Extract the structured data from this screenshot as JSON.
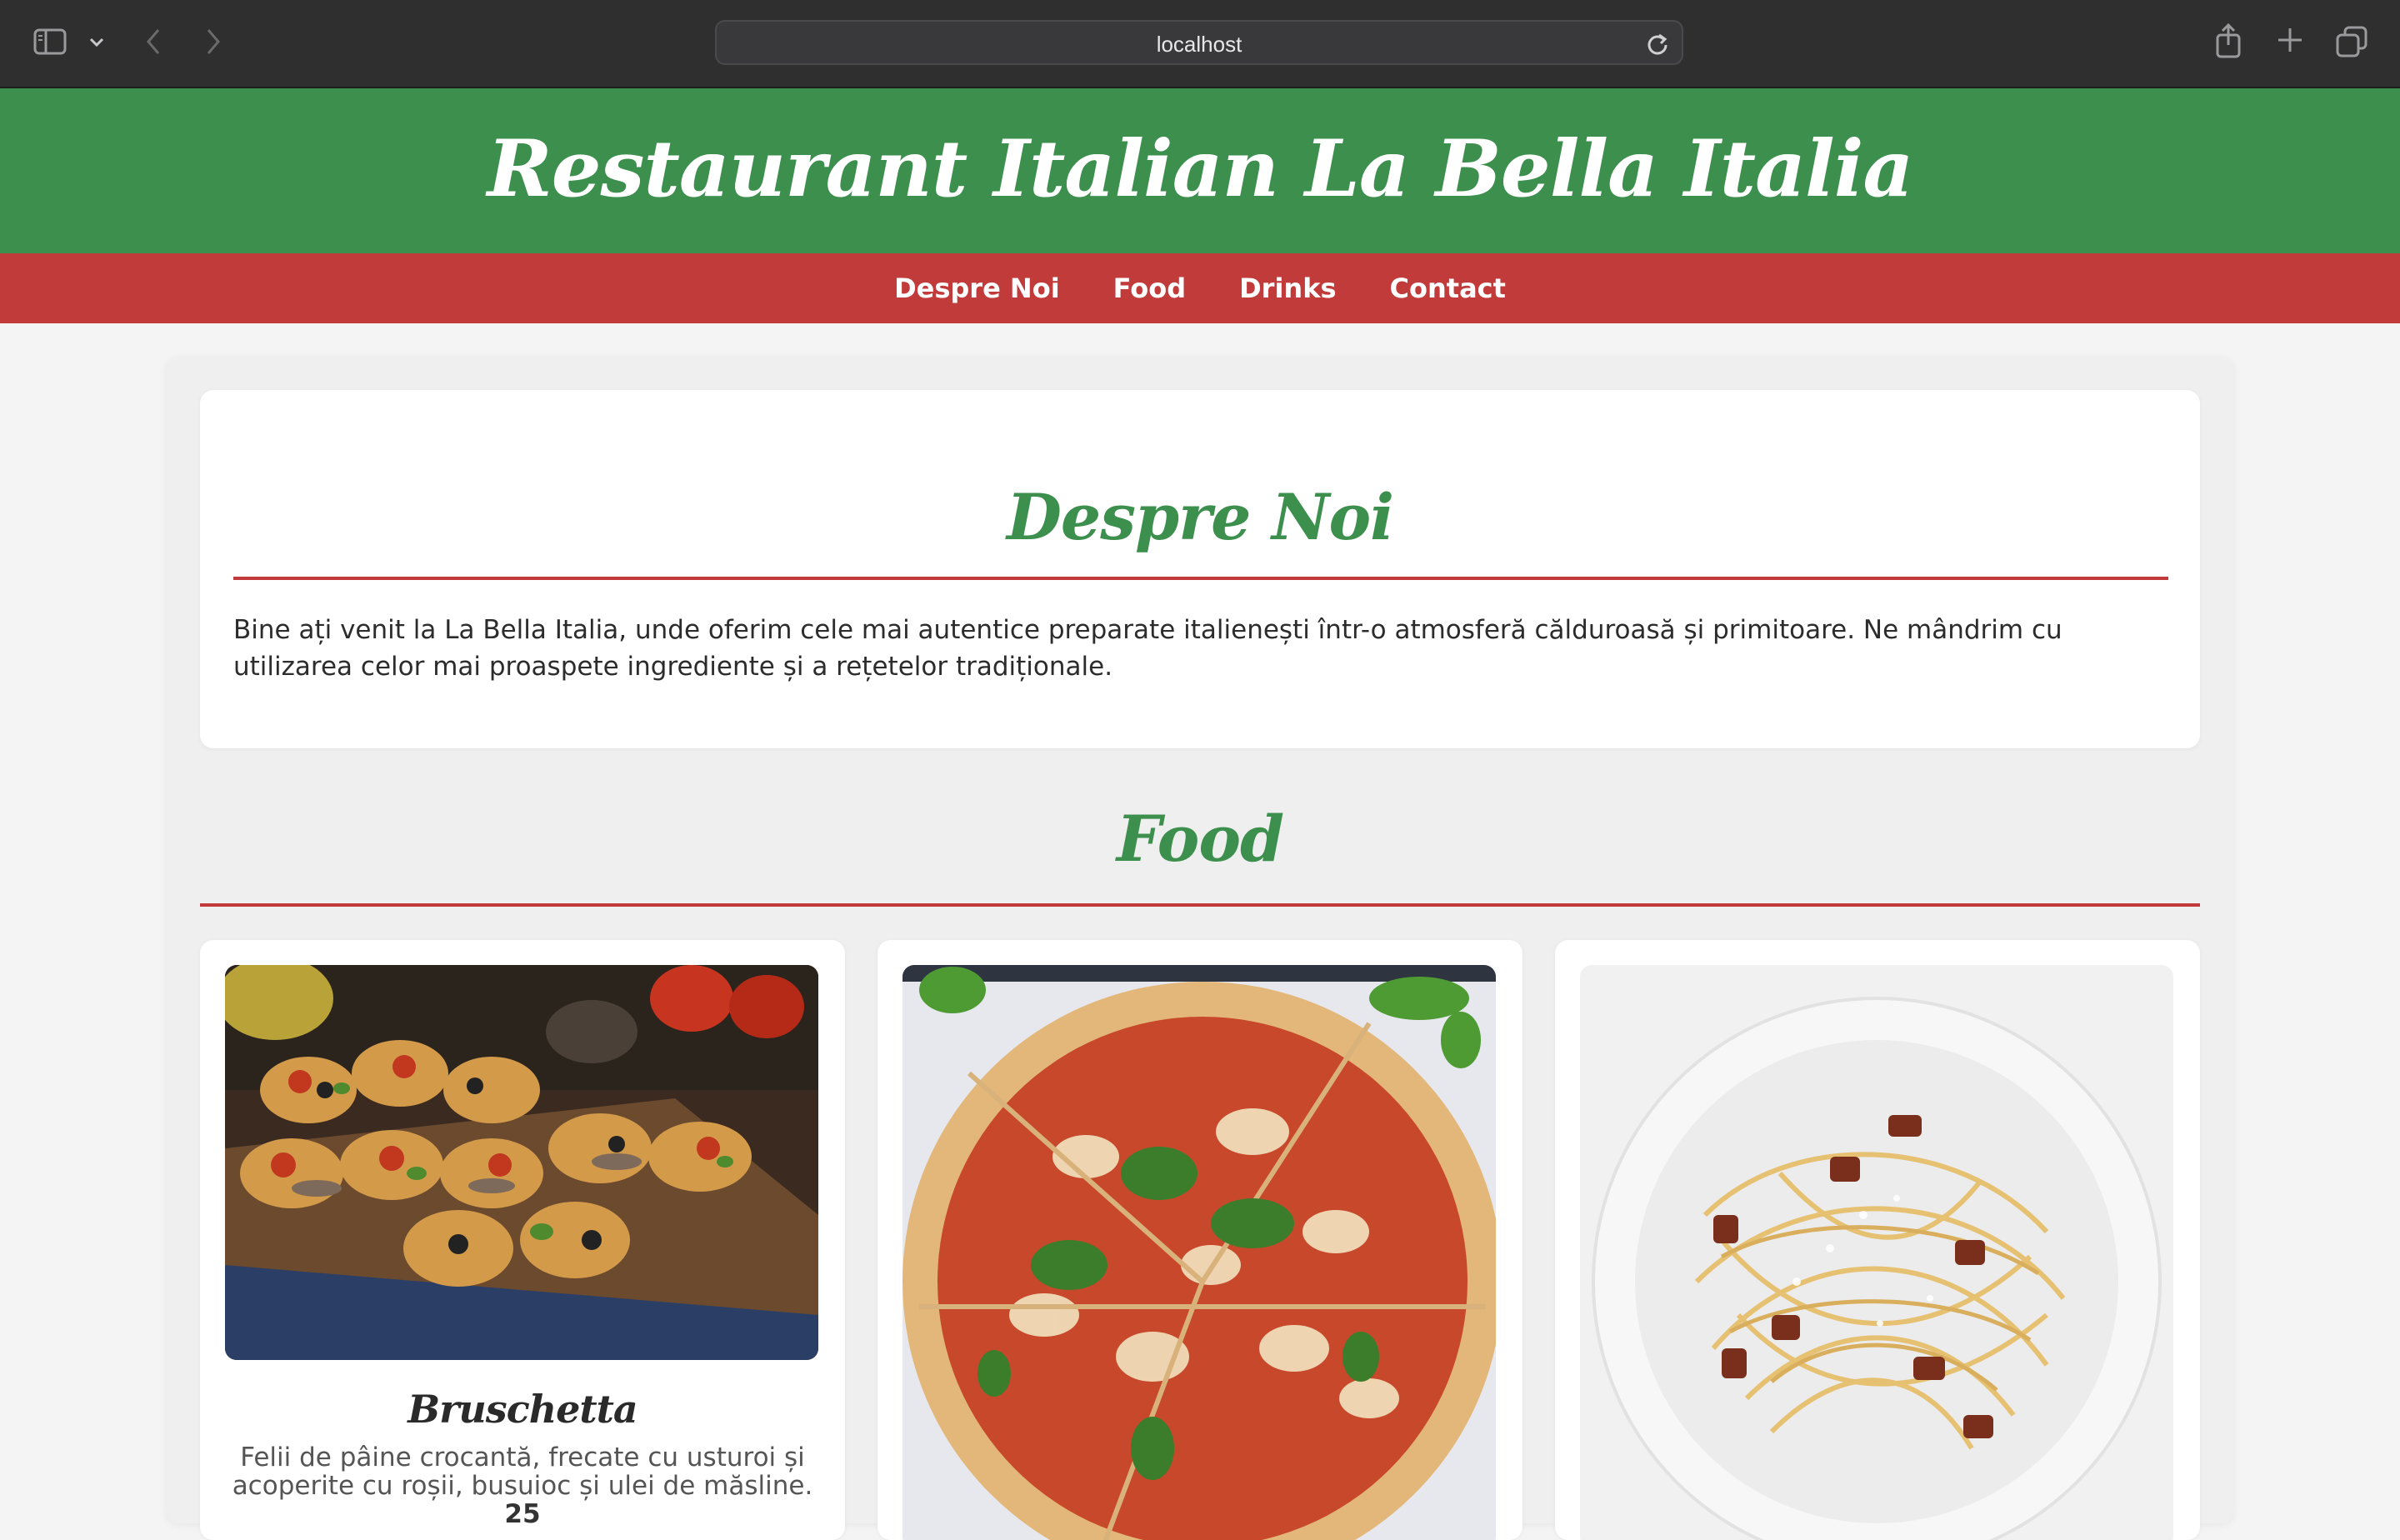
{
  "browser": {
    "address": "localhost"
  },
  "site": {
    "title": "Restaurant Italian La Bella Italia",
    "nav": [
      "Despre Noi",
      "Food",
      "Drinks",
      "Contact"
    ]
  },
  "about": {
    "heading": "Despre Noi",
    "text": "Bine ați venit la La Bella Italia, unde oferim cele mai autentice preparate italienești într-o atmosferă călduroasă și primitoare. Ne mândrim cu utilizarea celor mai proaspete ingrediente și a rețetelor tradiționale."
  },
  "food": {
    "heading": "Food",
    "items": [
      {
        "name": "Bruschetta",
        "description": "Felii de pâine crocantă, frecate cu usturoi și acoperite cu roșii, busuioc și ulei de măsline.",
        "price": "25"
      },
      {
        "name": "",
        "description": ""
      },
      {
        "name": "",
        "description": ""
      }
    ]
  },
  "colors": {
    "green": "#3c8f4d",
    "red": "#c23b3b",
    "background": "#f4f4f4"
  },
  "icons": [
    "sidebar-icon",
    "chevron-down-icon",
    "back-arrow-icon",
    "forward-arrow-icon",
    "reload-icon",
    "share-icon",
    "new-tab-icon",
    "tabs-overview-icon"
  ]
}
